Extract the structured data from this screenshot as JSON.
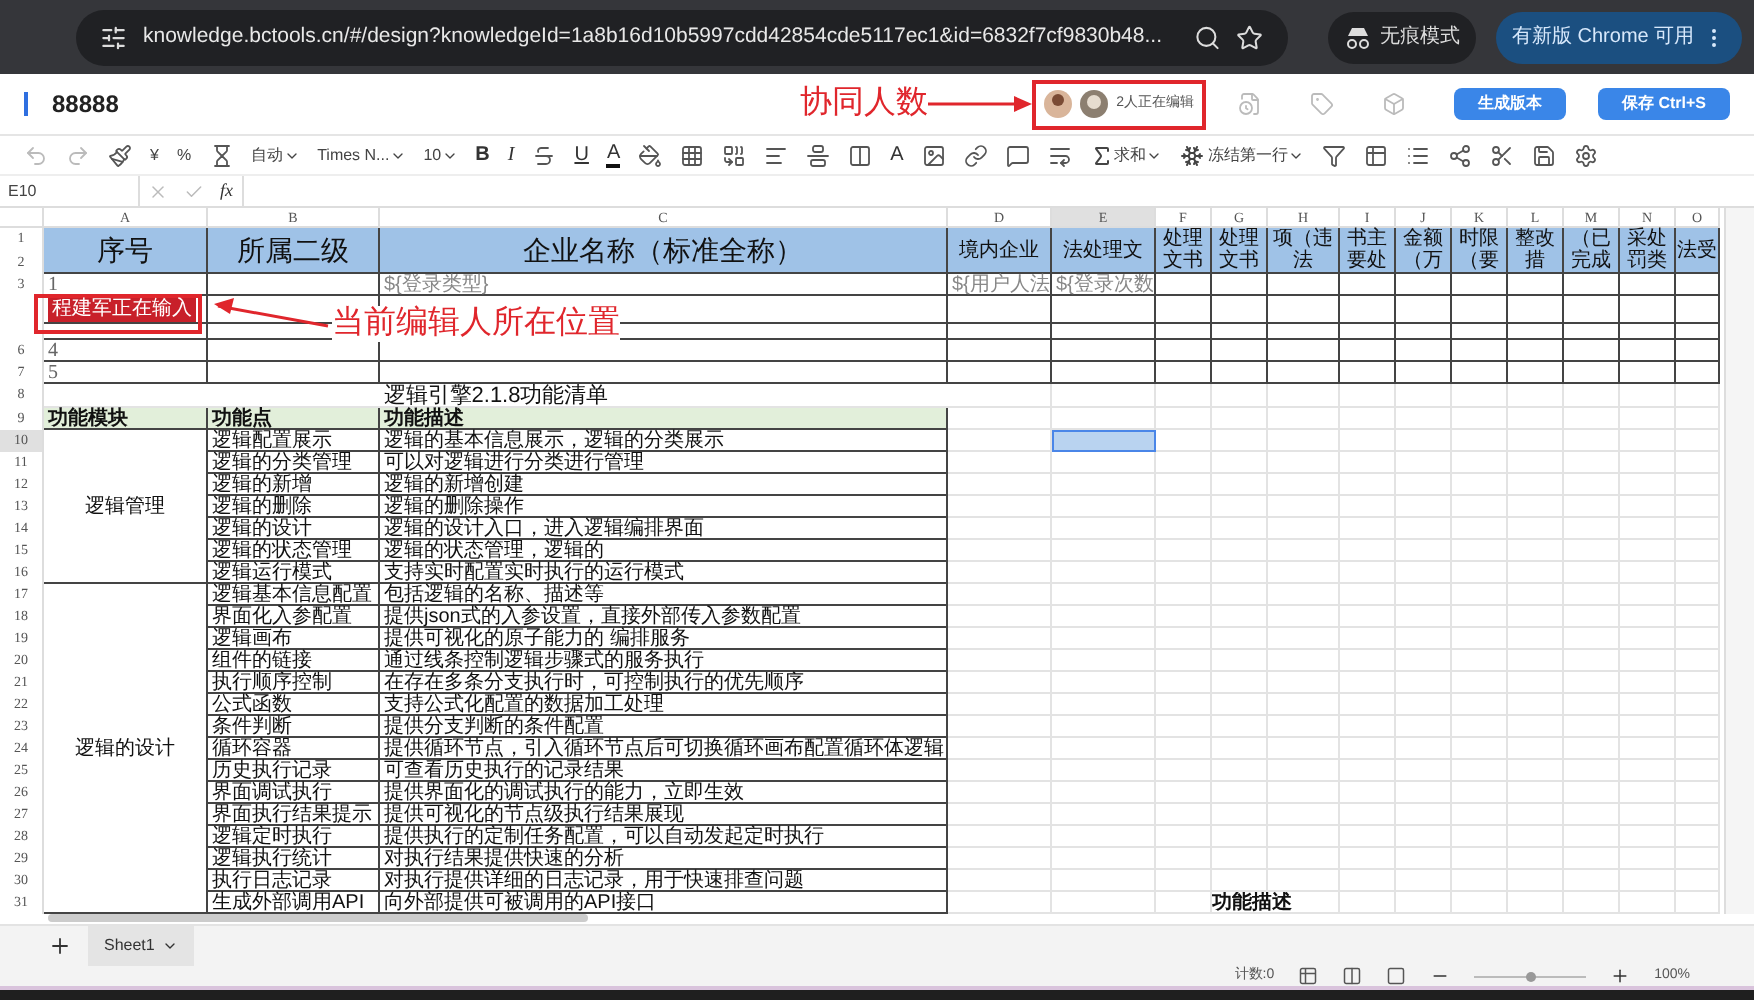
{
  "browser": {
    "url": "knowledge.bctools.cn/#/design?knowledgeId=1a8b16d10b5997cdd42854cde5117ec1&id=6832f7cf9830b48...",
    "incognito_label": "无痕模式",
    "update_button": "有新版 Chrome 可用"
  },
  "document": {
    "title": "88888",
    "editors_label": "2人正在编辑",
    "buttons": [
      "生成版本",
      "保存 Ctrl+S"
    ]
  },
  "annotations": [
    {
      "kind": "editors",
      "text": "协同人数"
    },
    {
      "kind": "position",
      "text": "当前编辑人所在位置"
    }
  ],
  "toolbar": {
    "currency": "¥",
    "percent": "%",
    "format": "自动",
    "font": "Times N...",
    "size": "10",
    "bold": "B",
    "italic": "I",
    "underline": "U",
    "text_color": "A",
    "fill_color": "A",
    "sum": "求和",
    "freeze": "冻结第一行"
  },
  "formula_bar": {
    "cell_ref": "E10",
    "fx": "fx"
  },
  "sheet": {
    "columns": [
      {
        "label": "A",
        "selected": false
      },
      {
        "label": "B",
        "selected": false
      },
      {
        "label": "C",
        "selected": false
      },
      {
        "label": "D",
        "selected": false
      },
      {
        "label": "E",
        "selected": true
      },
      {
        "label": "F",
        "selected": false
      },
      {
        "label": "G",
        "selected": false
      },
      {
        "label": "H",
        "selected": false
      },
      {
        "label": "I",
        "selected": false
      },
      {
        "label": "J",
        "selected": false
      },
      {
        "label": "K",
        "selected": false
      },
      {
        "label": "L",
        "selected": false
      },
      {
        "label": "M",
        "selected": false
      },
      {
        "label": "N",
        "selected": false
      },
      {
        "label": "O",
        "selected": false
      }
    ],
    "row_numbers": [
      {
        "label": "1",
        "selected": false
      },
      {
        "label": "2",
        "selected": false
      },
      {
        "label": "3",
        "selected": false
      },
      {
        "selected": false
      },
      {
        "selected": false
      },
      {
        "label": "6",
        "selected": false
      },
      {
        "label": "7",
        "selected": false
      },
      {
        "label": "8",
        "selected": false
      },
      {
        "label": "9",
        "selected": false
      },
      {
        "label": "10",
        "selected": true
      },
      {
        "label": "11",
        "selected": false
      },
      {
        "label": "12",
        "selected": false
      },
      {
        "label": "13",
        "selected": false
      },
      {
        "label": "14",
        "selected": false
      },
      {
        "label": "15",
        "selected": false
      },
      {
        "label": "16",
        "selected": false
      },
      {
        "label": "17",
        "selected": false
      },
      {
        "label": "18",
        "selected": false
      },
      {
        "label": "19",
        "selected": false
      },
      {
        "label": "20",
        "selected": false
      },
      {
        "label": "21",
        "selected": false
      },
      {
        "label": "22",
        "selected": false
      },
      {
        "label": "23",
        "selected": false
      },
      {
        "label": "24",
        "selected": false
      },
      {
        "label": "25",
        "selected": false
      },
      {
        "label": "26",
        "selected": false
      },
      {
        "label": "27",
        "selected": false
      },
      {
        "label": "28",
        "selected": false
      },
      {
        "label": "29",
        "selected": false
      },
      {
        "label": "30",
        "selected": false
      },
      {
        "label": "31",
        "selected": false
      }
    ],
    "header_row": [
      "序号",
      "所属二级",
      "企业名称（标准全称）",
      "境内企业",
      "法处理文",
      "处理文书",
      "处理文书",
      "项（违法",
      "书主要处",
      "金额（万",
      "时限（要",
      "整改措",
      "（已完成",
      "采处罚类",
      "法受"
    ],
    "data_rows": [
      {
        "cells": [
          "1",
          null,
          "${登录类型}",
          "${用户人法",
          "${登录次数"
        ]
      },
      {
        "editor": "程建军正在输入"
      },
      {},
      {
        "cells": [
          "4"
        ]
      },
      {
        "cells": [
          "5"
        ]
      }
    ],
    "feature_list": {
      "title": "逻辑引擎2.1.8功能清单",
      "headers": [
        "功能模块",
        "功能点",
        "功能描述"
      ],
      "groups": [
        {
          "module": "逻辑管理",
          "items": [
            {
              "point": "逻辑配置展示",
              "description": "逻辑的基本信息展示，逻辑的分类展示"
            },
            {
              "point": "逻辑的分类管理",
              "description": "可以对逻辑进行分类进行管理"
            },
            {
              "point": "逻辑的新增",
              "description": "逻辑的新增创建"
            },
            {
              "point": "逻辑的删除",
              "description": "逻辑的删除操作"
            },
            {
              "point": "逻辑的设计",
              "description": "逻辑的设计入口，进入逻辑编排界面"
            },
            {
              "point": "逻辑的状态管理",
              "description": "逻辑的状态管理，逻辑的"
            },
            {
              "point": "逻辑运行模式",
              "description": "支持实时配置实时执行的运行模式"
            }
          ]
        },
        {
          "module": "逻辑的设计",
          "items": [
            {
              "point": "逻辑基本信息配置",
              "description": "包括逻辑的名称、描述等"
            },
            {
              "point": "界面化入参配置",
              "description": "提供json式的入参设置，直接外部传入参数配置"
            },
            {
              "point": "逻辑画布",
              "description": "提供可视化的原子能力的 编排服务"
            },
            {
              "point": "组件的链接",
              "description": "通过线条控制逻辑步骤式的服务执行"
            },
            {
              "point": "执行顺序控制",
              "description": "在存在多条分支执行时，可控制执行的优先顺序"
            },
            {
              "point": "公式函数",
              "description": "支持公式化配置的数据加工处理"
            },
            {
              "point": "条件判断",
              "description": "提供分支判断的条件配置"
            },
            {
              "point": "循环容器",
              "description": "提供循环节点，引入循环节点后可切换循环画布配置循环体逻辑"
            },
            {
              "point": "历史执行记录",
              "description": "可查看历史执行的记录结果"
            },
            {
              "point": "界面调试执行",
              "description": "提供界面化的调试执行的能力，立即生效"
            },
            {
              "point": "界面执行结果提示",
              "description": "提供可视化的节点级执行结果展现"
            },
            {
              "point": "逻辑定时执行",
              "description": "提供执行的定制任务配置，可以自动发起定时执行"
            },
            {
              "point": "逻辑执行统计",
              "description": "对执行结果提供快速的分析"
            },
            {
              "point": "执行日志记录",
              "description": "对执行提供详细的日志记录，用于快速排查问题"
            },
            {
              "point": "生成外部调用API",
              "description": "向外部提供可被调用的API接口"
            }
          ]
        }
      ]
    },
    "dragged_label": "功能描述"
  },
  "sheet_tabs": [
    {
      "label": "Sheet1",
      "selected": true
    }
  ],
  "status_bar": {
    "count": "计数:0",
    "zoom": "100%",
    "zoom_level": {
      "level": 0.5
    }
  }
}
